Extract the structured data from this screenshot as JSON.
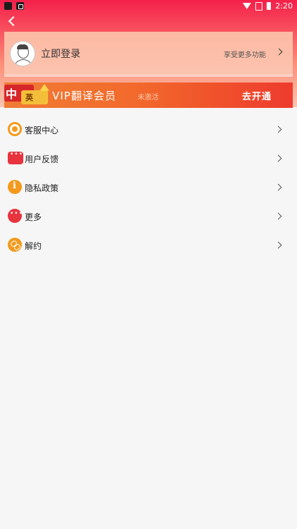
{
  "status_bar": {
    "time": "2:20"
  },
  "login": {
    "label": "立即登录",
    "hint": "享受更多功能"
  },
  "vip": {
    "icon_text_1": "中",
    "icon_text_2": "英",
    "title": "VIP翻译会员",
    "status": "未激活",
    "action": "去开通"
  },
  "menu": {
    "items": [
      {
        "label": "客服中心",
        "icon": "headset-icon"
      },
      {
        "label": "用户反馈",
        "icon": "chat-bubble-icon"
      },
      {
        "label": "隐私政策",
        "icon": "info-icon"
      },
      {
        "label": "更多",
        "icon": "more-dots-icon"
      },
      {
        "label": "解约",
        "icon": "unlink-icon"
      }
    ]
  }
}
